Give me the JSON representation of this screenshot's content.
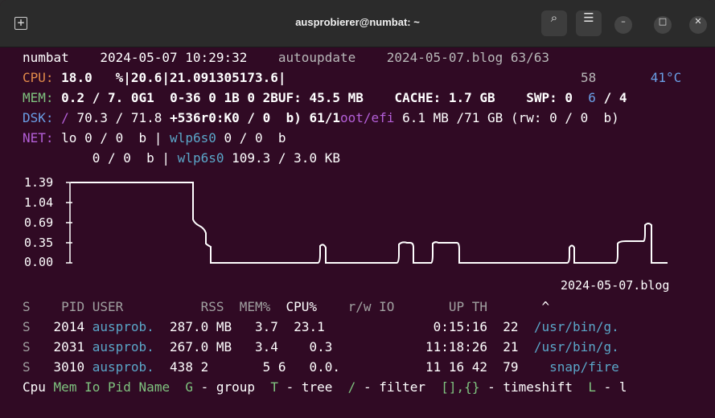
{
  "window": {
    "title": "ausprobierer@numbat: ~",
    "icons": [
      "new-tab-icon",
      "search-icon",
      "menu-icon",
      "minimize-icon",
      "maximize-icon",
      "close-icon"
    ]
  },
  "header": {
    "host": "numbat",
    "datetime": "2024-05-07 10:29:32",
    "mode": "autoupdate",
    "logfile": "2024-05-07.blog 63/63"
  },
  "cpu": {
    "label": "CPU:",
    "v1": "18.0",
    "v2": "%|20.6|21.091305173.6|",
    "num": "58",
    "temp": "41°C"
  },
  "mem": {
    "label": "MEM:",
    "p1": "0.2",
    "p2": "/ 7.",
    "p3": "0G1",
    "p4": "0-36 0 1B 0 2BUF:",
    "p5": "45.5 MB",
    "p6": "CACHE:",
    "p7": "1.7 GB",
    "p8": "SWP:",
    "p9": "0",
    "p10": "6",
    "p11": "/ 4"
  },
  "dsk": {
    "label": "DSK:",
    "p1": "/",
    "p2": "70.3 / 71.8",
    "p3": "+536r0:K0 / 0",
    "p4": "b) 61/1",
    "p5": "oot/efi",
    "p6": "6.1 MB /71 GB (rw: 0 / 0  b)"
  },
  "net": {
    "label": "NET:",
    "if1": "lo",
    "v1": "0 / 0  b |",
    "if2": "wlp6s0",
    "v2": "0 / 0  b",
    "v3": "0 / 0  b |",
    "if3": "wlp6s0",
    "v4": "109.3 / 3.0 KB"
  },
  "graph": {
    "yticks": [
      "1.39",
      "1.04",
      "0.69",
      "0.35",
      "0.00"
    ],
    "filename": "2024-05-07.blog"
  },
  "table": {
    "headers": [
      "S",
      "PID USER",
      "RSS",
      "MEM%",
      "CPU%",
      "r/w IO",
      "UP TH",
      "^"
    ],
    "rows": [
      {
        "s": "S",
        "pid": "2014",
        "user": "ausprob.",
        "rss": "287.0 MB",
        "mem": "3.7",
        "cpu": "23.1",
        "up": "0:15:16",
        "th": "22",
        "cmd": "/usr/bin/g."
      },
      {
        "s": "S",
        "pid": "2031",
        "user": "ausprob.",
        "rss": "267.0 MB",
        "mem": "3.4",
        "cpu": "0.3",
        "up": "11:18:26",
        "th": "21",
        "cmd": "/usr/bin/g."
      },
      {
        "s": "S",
        "pid": "3010",
        "user": "ausprob.",
        "rss": "438 2",
        "mem": "5 6",
        "cpu": "0.0.",
        "up": "11 16 42",
        "th": "79",
        "cmd": "snap/fire"
      }
    ]
  },
  "footer": {
    "cpu": "Cpu",
    "mem": "Mem",
    "io": "Io",
    "pid": "Pid",
    "name": "Name",
    "g": "G",
    "group": "- group",
    "t": "T",
    "tree": "- tree",
    "slash": "/",
    "filter": "- filter",
    "brackets": "[],{}",
    "timeshift": "- timeshift",
    "l": "L",
    "l2": "- l"
  },
  "colors": {
    "bg": "#300a24",
    "orange": "#e38b4a",
    "green": "#7fc37f",
    "blue": "#6a9fe6",
    "purple": "#b45fd8"
  }
}
